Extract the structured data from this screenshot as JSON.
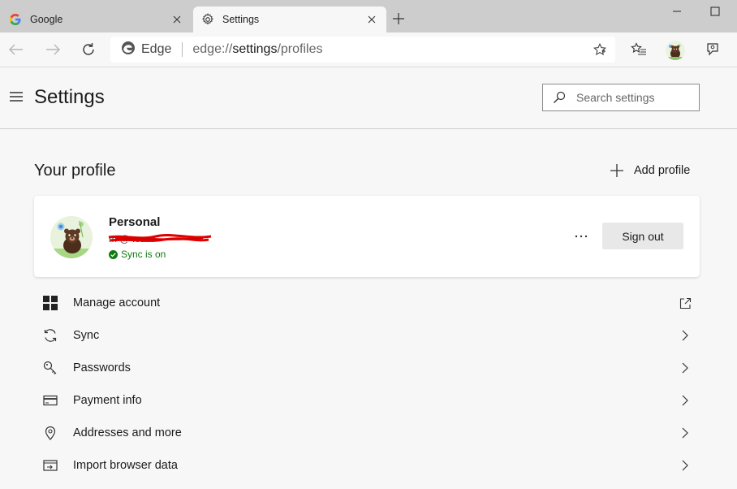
{
  "tabs": [
    {
      "title": "Google",
      "active": false,
      "favicon": "google-icon"
    },
    {
      "title": "Settings",
      "active": true,
      "favicon": "gear-icon"
    }
  ],
  "address": {
    "site_label": "Edge",
    "url_prefix": "edge://",
    "url_main": "settings",
    "url_suffix": "/profiles"
  },
  "header": {
    "title": "Settings",
    "search_placeholder": "Search settings"
  },
  "profile_section": {
    "title": "Your profile",
    "add_profile_label": "Add profile"
  },
  "profile": {
    "name": "Personal",
    "email_visible": "m        @     .com",
    "sync_status": "Sync is on",
    "sign_out_label": "Sign out"
  },
  "menu": [
    {
      "label": "Manage account",
      "icon": "windows-logo-icon",
      "action": "external-link-icon"
    },
    {
      "label": "Sync",
      "icon": "sync-icon",
      "action": "chevron-right-icon"
    },
    {
      "label": "Passwords",
      "icon": "key-icon",
      "action": "chevron-right-icon"
    },
    {
      "label": "Payment info",
      "icon": "credit-card-icon",
      "action": "chevron-right-icon"
    },
    {
      "label": "Addresses and more",
      "icon": "location-pin-icon",
      "action": "chevron-right-icon"
    },
    {
      "label": "Import browser data",
      "icon": "import-icon",
      "action": "chevron-right-icon"
    }
  ],
  "colors": {
    "sync_green": "#107c10",
    "redaction": "#e00000",
    "tabstrip_bg": "#cdcdcd"
  }
}
